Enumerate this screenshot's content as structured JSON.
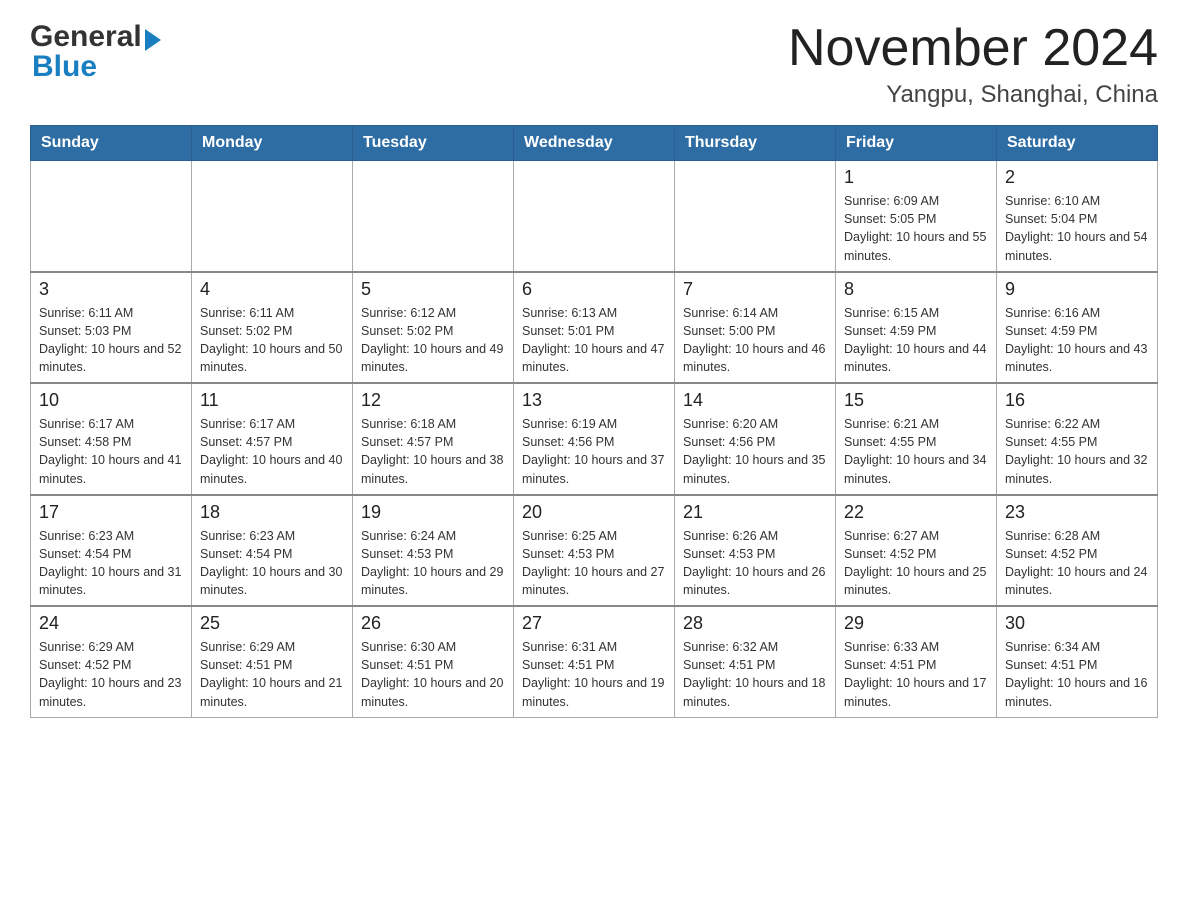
{
  "logo": {
    "general": "General",
    "blue": "Blue"
  },
  "title": "November 2024",
  "subtitle": "Yangpu, Shanghai, China",
  "days_of_week": [
    "Sunday",
    "Monday",
    "Tuesday",
    "Wednesday",
    "Thursday",
    "Friday",
    "Saturday"
  ],
  "weeks": [
    [
      {
        "day": "",
        "sunrise": "",
        "sunset": "",
        "daylight": ""
      },
      {
        "day": "",
        "sunrise": "",
        "sunset": "",
        "daylight": ""
      },
      {
        "day": "",
        "sunrise": "",
        "sunset": "",
        "daylight": ""
      },
      {
        "day": "",
        "sunrise": "",
        "sunset": "",
        "daylight": ""
      },
      {
        "day": "",
        "sunrise": "",
        "sunset": "",
        "daylight": ""
      },
      {
        "day": "1",
        "sunrise": "Sunrise: 6:09 AM",
        "sunset": "Sunset: 5:05 PM",
        "daylight": "Daylight: 10 hours and 55 minutes."
      },
      {
        "day": "2",
        "sunrise": "Sunrise: 6:10 AM",
        "sunset": "Sunset: 5:04 PM",
        "daylight": "Daylight: 10 hours and 54 minutes."
      }
    ],
    [
      {
        "day": "3",
        "sunrise": "Sunrise: 6:11 AM",
        "sunset": "Sunset: 5:03 PM",
        "daylight": "Daylight: 10 hours and 52 minutes."
      },
      {
        "day": "4",
        "sunrise": "Sunrise: 6:11 AM",
        "sunset": "Sunset: 5:02 PM",
        "daylight": "Daylight: 10 hours and 50 minutes."
      },
      {
        "day": "5",
        "sunrise": "Sunrise: 6:12 AM",
        "sunset": "Sunset: 5:02 PM",
        "daylight": "Daylight: 10 hours and 49 minutes."
      },
      {
        "day": "6",
        "sunrise": "Sunrise: 6:13 AM",
        "sunset": "Sunset: 5:01 PM",
        "daylight": "Daylight: 10 hours and 47 minutes."
      },
      {
        "day": "7",
        "sunrise": "Sunrise: 6:14 AM",
        "sunset": "Sunset: 5:00 PM",
        "daylight": "Daylight: 10 hours and 46 minutes."
      },
      {
        "day": "8",
        "sunrise": "Sunrise: 6:15 AM",
        "sunset": "Sunset: 4:59 PM",
        "daylight": "Daylight: 10 hours and 44 minutes."
      },
      {
        "day": "9",
        "sunrise": "Sunrise: 6:16 AM",
        "sunset": "Sunset: 4:59 PM",
        "daylight": "Daylight: 10 hours and 43 minutes."
      }
    ],
    [
      {
        "day": "10",
        "sunrise": "Sunrise: 6:17 AM",
        "sunset": "Sunset: 4:58 PM",
        "daylight": "Daylight: 10 hours and 41 minutes."
      },
      {
        "day": "11",
        "sunrise": "Sunrise: 6:17 AM",
        "sunset": "Sunset: 4:57 PM",
        "daylight": "Daylight: 10 hours and 40 minutes."
      },
      {
        "day": "12",
        "sunrise": "Sunrise: 6:18 AM",
        "sunset": "Sunset: 4:57 PM",
        "daylight": "Daylight: 10 hours and 38 minutes."
      },
      {
        "day": "13",
        "sunrise": "Sunrise: 6:19 AM",
        "sunset": "Sunset: 4:56 PM",
        "daylight": "Daylight: 10 hours and 37 minutes."
      },
      {
        "day": "14",
        "sunrise": "Sunrise: 6:20 AM",
        "sunset": "Sunset: 4:56 PM",
        "daylight": "Daylight: 10 hours and 35 minutes."
      },
      {
        "day": "15",
        "sunrise": "Sunrise: 6:21 AM",
        "sunset": "Sunset: 4:55 PM",
        "daylight": "Daylight: 10 hours and 34 minutes."
      },
      {
        "day": "16",
        "sunrise": "Sunrise: 6:22 AM",
        "sunset": "Sunset: 4:55 PM",
        "daylight": "Daylight: 10 hours and 32 minutes."
      }
    ],
    [
      {
        "day": "17",
        "sunrise": "Sunrise: 6:23 AM",
        "sunset": "Sunset: 4:54 PM",
        "daylight": "Daylight: 10 hours and 31 minutes."
      },
      {
        "day": "18",
        "sunrise": "Sunrise: 6:23 AM",
        "sunset": "Sunset: 4:54 PM",
        "daylight": "Daylight: 10 hours and 30 minutes."
      },
      {
        "day": "19",
        "sunrise": "Sunrise: 6:24 AM",
        "sunset": "Sunset: 4:53 PM",
        "daylight": "Daylight: 10 hours and 29 minutes."
      },
      {
        "day": "20",
        "sunrise": "Sunrise: 6:25 AM",
        "sunset": "Sunset: 4:53 PM",
        "daylight": "Daylight: 10 hours and 27 minutes."
      },
      {
        "day": "21",
        "sunrise": "Sunrise: 6:26 AM",
        "sunset": "Sunset: 4:53 PM",
        "daylight": "Daylight: 10 hours and 26 minutes."
      },
      {
        "day": "22",
        "sunrise": "Sunrise: 6:27 AM",
        "sunset": "Sunset: 4:52 PM",
        "daylight": "Daylight: 10 hours and 25 minutes."
      },
      {
        "day": "23",
        "sunrise": "Sunrise: 6:28 AM",
        "sunset": "Sunset: 4:52 PM",
        "daylight": "Daylight: 10 hours and 24 minutes."
      }
    ],
    [
      {
        "day": "24",
        "sunrise": "Sunrise: 6:29 AM",
        "sunset": "Sunset: 4:52 PM",
        "daylight": "Daylight: 10 hours and 23 minutes."
      },
      {
        "day": "25",
        "sunrise": "Sunrise: 6:29 AM",
        "sunset": "Sunset: 4:51 PM",
        "daylight": "Daylight: 10 hours and 21 minutes."
      },
      {
        "day": "26",
        "sunrise": "Sunrise: 6:30 AM",
        "sunset": "Sunset: 4:51 PM",
        "daylight": "Daylight: 10 hours and 20 minutes."
      },
      {
        "day": "27",
        "sunrise": "Sunrise: 6:31 AM",
        "sunset": "Sunset: 4:51 PM",
        "daylight": "Daylight: 10 hours and 19 minutes."
      },
      {
        "day": "28",
        "sunrise": "Sunrise: 6:32 AM",
        "sunset": "Sunset: 4:51 PM",
        "daylight": "Daylight: 10 hours and 18 minutes."
      },
      {
        "day": "29",
        "sunrise": "Sunrise: 6:33 AM",
        "sunset": "Sunset: 4:51 PM",
        "daylight": "Daylight: 10 hours and 17 minutes."
      },
      {
        "day": "30",
        "sunrise": "Sunrise: 6:34 AM",
        "sunset": "Sunset: 4:51 PM",
        "daylight": "Daylight: 10 hours and 16 minutes."
      }
    ]
  ]
}
